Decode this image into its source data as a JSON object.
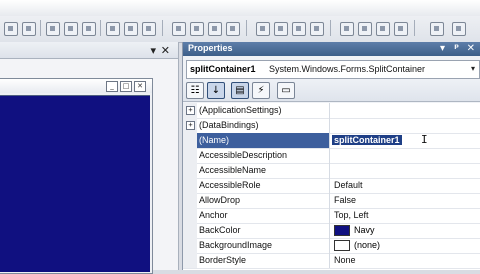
{
  "left_pane": {
    "pin_glyph": "▾",
    "close_glyph": "✕",
    "form_buttons": [
      "_",
      "□",
      "✕"
    ]
  },
  "properties": {
    "title": "Properties",
    "title_pin": "▾",
    "title_pin2": "ᵖ",
    "title_close": "✕",
    "object": {
      "name": "splitContainer1",
      "type": "System.Windows.Forms.SplitContainer",
      "dropdown": "▾"
    },
    "toolbar": {
      "categorized": "☷",
      "alphabetical": "↓",
      "properties": "▤",
      "events": "⚡",
      "pages": "▭"
    },
    "rows": [
      {
        "expander": "+",
        "name": "(ApplicationSettings)",
        "value": ""
      },
      {
        "expander": "+",
        "name": "(DataBindings)",
        "value": ""
      },
      {
        "expander": "",
        "name": "(Name)",
        "value": "splitContainer1",
        "selected": true
      },
      {
        "expander": "",
        "name": "AccessibleDescription",
        "value": ""
      },
      {
        "expander": "",
        "name": "AccessibleName",
        "value": ""
      },
      {
        "expander": "",
        "name": "AccessibleRole",
        "value": "Default"
      },
      {
        "expander": "",
        "name": "AllowDrop",
        "value": "False"
      },
      {
        "expander": "",
        "name": "Anchor",
        "value": "Top, Left"
      },
      {
        "expander": "",
        "name": "BackColor",
        "value": "Navy",
        "swatch": "#101080"
      },
      {
        "expander": "",
        "name": "BackgroundImage",
        "value": "(none)",
        "swatch": "#ffffff"
      },
      {
        "expander": "",
        "name": "BorderStyle",
        "value": "None"
      }
    ]
  },
  "colors": {
    "navy_panel": "#101080",
    "title_bar": "#3d5f89",
    "selection": "#3d5f9d"
  }
}
